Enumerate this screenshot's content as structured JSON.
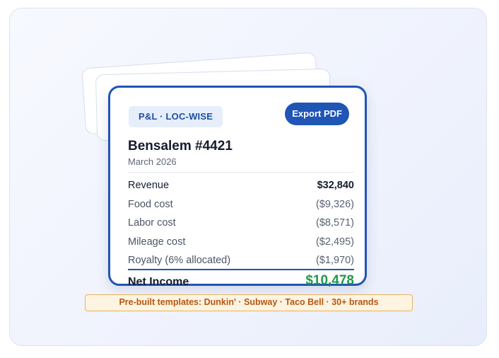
{
  "card": {
    "tag": "P&L · LOC-WISE",
    "export_label": "Export PDF",
    "location_name": "Bensalem #4421",
    "period": "March 2026",
    "rows": [
      {
        "label": "Revenue",
        "amount": "$32,840"
      },
      {
        "label": "Food cost",
        "amount": "($9,326)"
      },
      {
        "label": "Labor cost",
        "amount": "($8,571)"
      },
      {
        "label": "Mileage cost",
        "amount": "($2,495)"
      },
      {
        "label": "Royalty (6% allocated)",
        "amount": "($1,970)"
      }
    ],
    "net_label": "Net Income",
    "net_value": "$10,478"
  },
  "banner": {
    "text": "Pre-built templates: Dunkin' · Subway · Taco Bell · 30+ brands"
  },
  "colors": {
    "accent": "#1f55b5",
    "net_income": "#1f9a4a",
    "banner_text": "#b5560f",
    "banner_border": "#e8b25b",
    "banner_bg": "#fff4e1"
  }
}
